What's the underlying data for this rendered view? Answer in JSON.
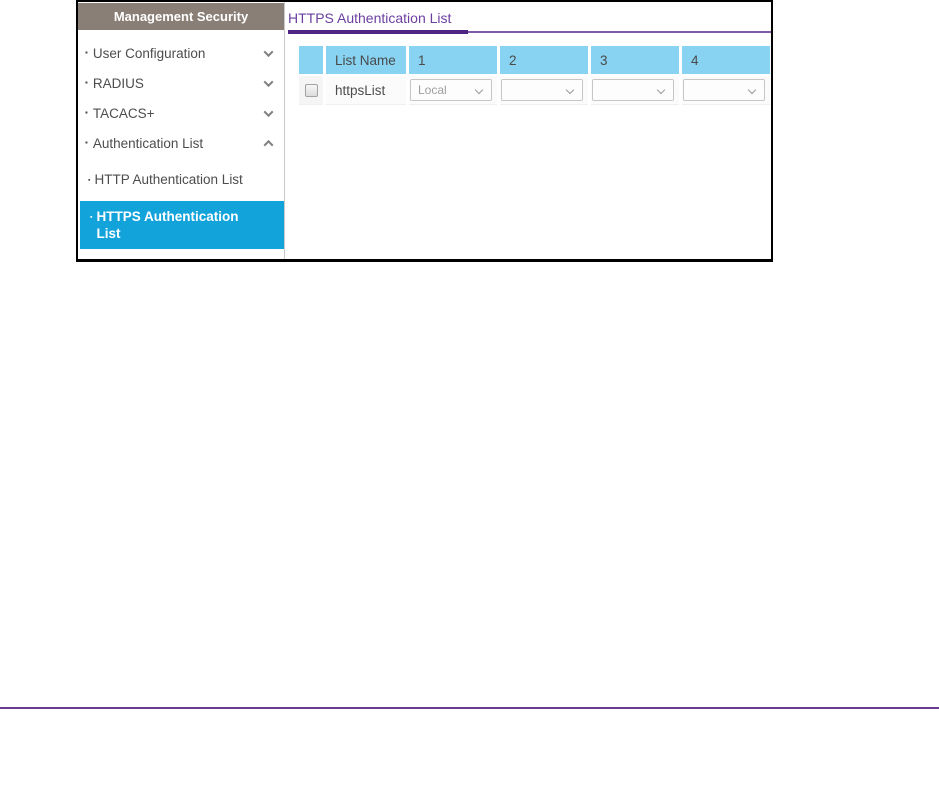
{
  "sidebar": {
    "header": "Management Security",
    "items": [
      {
        "label": "User Configuration",
        "state": "collapsed"
      },
      {
        "label": "RADIUS",
        "state": "collapsed"
      },
      {
        "label": "TACACS+",
        "state": "collapsed"
      },
      {
        "label": "Authentication List",
        "state": "expanded"
      }
    ],
    "subitems": [
      {
        "label": "HTTP Authentication List",
        "selected": false
      },
      {
        "label": "HTTPS Authentication List",
        "selected": true
      }
    ]
  },
  "main": {
    "title": "HTTPS Authentication List",
    "table": {
      "headers": [
        "List Name",
        "1",
        "2",
        "3",
        "4"
      ],
      "row": {
        "list_name": "httpsList",
        "selects": [
          "Local",
          "",
          "",
          ""
        ]
      }
    }
  },
  "colors": {
    "selected_item_blue": "#12A3DB",
    "table_header_blue": "#87D3F1",
    "title_purple": "#6B3FA0",
    "rule_purple_dark": "#4E2483",
    "rule_purple_light": "#7D5BA6",
    "page_divider_purple": "#6A3D91",
    "sidebar_header_taupe": "#8A7F76"
  }
}
